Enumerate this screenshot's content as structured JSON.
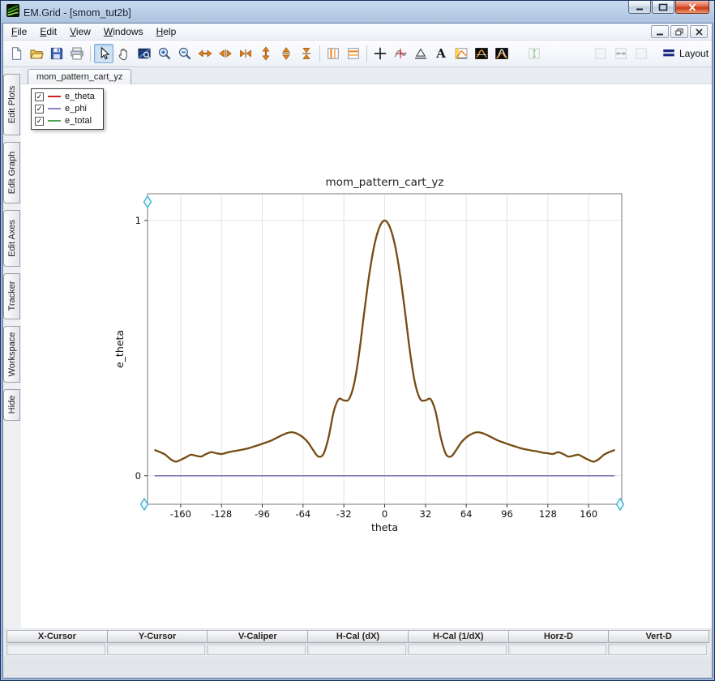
{
  "window": {
    "title": "EM.Grid - [smom_tut2b]"
  },
  "menu": {
    "items": [
      "File",
      "Edit",
      "View",
      "Windows",
      "Help"
    ]
  },
  "toolbar": {
    "items": [
      {
        "icon": "new-document"
      },
      {
        "icon": "open-folder"
      },
      {
        "icon": "save-floppy"
      },
      {
        "icon": "print"
      },
      {
        "sep": true
      },
      {
        "icon": "pointer-select",
        "pressed": true
      },
      {
        "icon": "pan-hand"
      },
      {
        "icon": "zoom-window"
      },
      {
        "icon": "zoom-in"
      },
      {
        "icon": "zoom-out"
      },
      {
        "icon": "expand-x"
      },
      {
        "icon": "split-x"
      },
      {
        "icon": "compress-x"
      },
      {
        "icon": "expand-y"
      },
      {
        "icon": "split-y"
      },
      {
        "icon": "compress-y"
      },
      {
        "sep": true
      },
      {
        "icon": "vertical-markers"
      },
      {
        "icon": "horizontal-markers"
      },
      {
        "sep": true
      },
      {
        "icon": "crosshair"
      },
      {
        "icon": "curve-tracker"
      },
      {
        "icon": "caliper"
      },
      {
        "icon": "text-annotation"
      },
      {
        "icon": "insert-plot"
      },
      {
        "icon": "waveform-dark"
      },
      {
        "icon": "waveform-gauss-dark"
      },
      {
        "space": 14
      },
      {
        "icon": "fit-vertical",
        "disabled": true
      },
      {
        "space": 56
      },
      {
        "icon": "frame-empty",
        "disabled": true
      },
      {
        "icon": "fit-horizontal",
        "disabled": true
      },
      {
        "icon": "frame-empty",
        "disabled": true
      },
      {
        "space": 6
      },
      {
        "icon": "layout",
        "label": "Layout"
      }
    ]
  },
  "sidebar": {
    "tabs": [
      "Edit Plots",
      "Edit Graph",
      "Edit Axes",
      "Tracker",
      "Workspace",
      "Hide"
    ]
  },
  "document_tabs": [
    {
      "label": "mom_pattern_cart_yz",
      "active": true
    }
  ],
  "legend": {
    "items": [
      {
        "label": "e_theta",
        "checked": true,
        "color": "#cc2222"
      },
      {
        "label": "e_phi",
        "checked": true,
        "color": "#8884c8"
      },
      {
        "label": "e_total",
        "checked": true,
        "color": "#55a055"
      }
    ]
  },
  "chart_data": {
    "type": "line",
    "title": "mom_pattern_cart_yz",
    "xlabel": "theta",
    "ylabel": "e_theta",
    "xlim": [
      -186,
      186
    ],
    "ylim": [
      -0.112,
      1.105
    ],
    "xticks": [
      -160,
      -128,
      -96,
      -64,
      -32,
      0,
      32,
      64,
      96,
      128,
      160
    ],
    "yticks": [
      0,
      1
    ],
    "grid": true,
    "legend_position": "top-left-overlay",
    "handles_color": "#38aed0",
    "series": [
      {
        "name": "e_theta",
        "legend_color": "#cc2222",
        "draw_color": "#7b4a14",
        "width": 2.2,
        "x": [
          -180,
          -176,
          -172,
          -168,
          -164,
          -160,
          -156,
          -152,
          -148,
          -144,
          -140,
          -136,
          -132,
          -128,
          -124,
          -120,
          -116,
          -112,
          -108,
          -104,
          -100,
          -96,
          -92,
          -88,
          -84,
          -80,
          -76,
          -72,
          -68,
          -64,
          -60,
          -56,
          -52,
          -48,
          -44,
          -40,
          -36,
          -32,
          -28,
          -24,
          -20,
          -16,
          -12,
          -8,
          -4,
          0,
          4,
          8,
          12,
          16,
          20,
          24,
          28,
          32,
          36,
          40,
          44,
          48,
          52,
          56,
          60,
          64,
          68,
          72,
          76,
          80,
          84,
          88,
          92,
          96,
          100,
          104,
          108,
          112,
          116,
          120,
          124,
          128,
          132,
          136,
          140,
          144,
          148,
          152,
          156,
          160,
          164,
          168,
          172,
          176,
          180
        ],
        "y": [
          0.1,
          0.092,
          0.082,
          0.065,
          0.055,
          0.062,
          0.072,
          0.082,
          0.078,
          0.075,
          0.085,
          0.092,
          0.088,
          0.085,
          0.09,
          0.095,
          0.098,
          0.102,
          0.106,
          0.112,
          0.118,
          0.125,
          0.132,
          0.14,
          0.15,
          0.16,
          0.168,
          0.17,
          0.163,
          0.15,
          0.13,
          0.1,
          0.075,
          0.085,
          0.15,
          0.25,
          0.3,
          0.295,
          0.3,
          0.36,
          0.48,
          0.64,
          0.79,
          0.905,
          0.975,
          1.0,
          0.975,
          0.905,
          0.79,
          0.64,
          0.48,
          0.36,
          0.3,
          0.295,
          0.3,
          0.25,
          0.15,
          0.085,
          0.075,
          0.1,
          0.13,
          0.15,
          0.163,
          0.17,
          0.168,
          0.16,
          0.15,
          0.14,
          0.132,
          0.125,
          0.118,
          0.112,
          0.106,
          0.102,
          0.098,
          0.095,
          0.09,
          0.088,
          0.085,
          0.092,
          0.085,
          0.075,
          0.078,
          0.082,
          0.072,
          0.062,
          0.055,
          0.065,
          0.082,
          0.092,
          0.1
        ]
      },
      {
        "name": "e_phi",
        "legend_color": "#8884c8",
        "draw_color": "#7e7ab2",
        "width": 1.6,
        "x": [
          -180,
          180
        ],
        "y": [
          0,
          0
        ]
      },
      {
        "name": "e_total",
        "legend_color": "#55a055",
        "draw_color": "#55a055",
        "width": 2.2,
        "same_data_as": "e_theta",
        "note": "coincides with e_theta; hidden beneath it in the plot"
      }
    ]
  },
  "bottom_table": {
    "columns": [
      "X-Cursor",
      "Y-Cursor",
      "V-Caliper",
      "H-Cal (dX)",
      "H-Cal (1/dX)",
      "Horz-D",
      "Vert-D"
    ],
    "values": [
      "",
      "",
      "",
      "",
      "",
      "",
      ""
    ]
  }
}
